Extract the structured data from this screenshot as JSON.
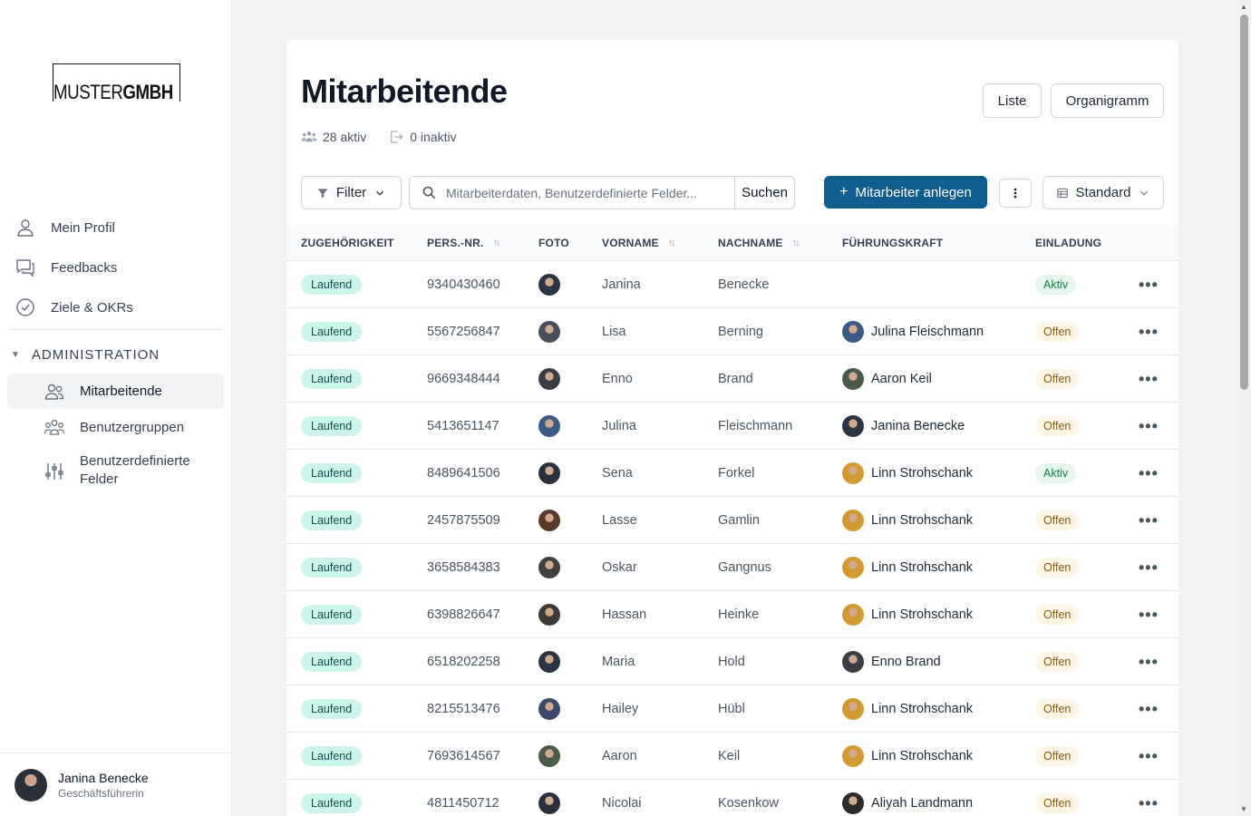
{
  "brand": {
    "logo_left": "MUSTER",
    "logo_right": "GMBH"
  },
  "nav": {
    "items": [
      {
        "label": "Mein Profil",
        "icon": "user-icon"
      },
      {
        "label": "Feedbacks",
        "icon": "chat-icon"
      },
      {
        "label": "Ziele & OKRs",
        "icon": "check-circle-icon"
      }
    ],
    "admin_label": "ADMINISTRATION",
    "admin_items": [
      {
        "label": "Mitarbeitende",
        "icon": "users-icon",
        "active": true
      },
      {
        "label": "Benutzergruppen",
        "icon": "group-icon"
      },
      {
        "label": "Benutzerdefinierte Felder",
        "icon": "sliders-icon"
      }
    ]
  },
  "user": {
    "name": "Janina Benecke",
    "role": "Geschäftsführerin"
  },
  "page": {
    "title": "Mitarbeitende",
    "active_count": "28 aktiv",
    "inactive_count": "0 inaktiv",
    "view_list": "Liste",
    "view_org": "Organigramm"
  },
  "toolbar": {
    "filter_label": "Filter",
    "search_placeholder": "Mitarbeiterdaten, Benutzerdefinierte Felder...",
    "search_button": "Suchen",
    "create_button": "Mitarbeiter anlegen",
    "view_select": "Standard"
  },
  "table": {
    "headers": [
      "ZUGEHÖRIGKEIT",
      "PERS.-NR.",
      "FOTO",
      "VORNAME",
      "NACHNAME",
      "FÜHRUNGSKRAFT",
      "EINLADUNG"
    ],
    "rows": [
      {
        "status": "Laufend",
        "nr": "9340430460",
        "first": "Janina",
        "last": "Benecke",
        "manager": "",
        "invite": "Aktiv",
        "photo": "#2c3546",
        "mphoto": ""
      },
      {
        "status": "Laufend",
        "nr": "5567256847",
        "first": "Lisa",
        "last": "Berning",
        "manager": "Julina Fleischmann",
        "invite": "Offen",
        "photo": "#4a4f5e",
        "mphoto": "#3b5a86"
      },
      {
        "status": "Laufend",
        "nr": "9669348444",
        "first": "Enno",
        "last": "Brand",
        "manager": "Aaron Keil",
        "invite": "Offen",
        "photo": "#3a3d44",
        "mphoto": "#4a5b4a"
      },
      {
        "status": "Laufend",
        "nr": "5413651147",
        "first": "Julina",
        "last": "Fleischmann",
        "manager": "Janina Benecke",
        "invite": "Offen",
        "photo": "#3b5a86",
        "mphoto": "#2c3546"
      },
      {
        "status": "Laufend",
        "nr": "8489641506",
        "first": "Sena",
        "last": "Forkel",
        "manager": "Linn Strohschank",
        "invite": "Aktiv",
        "photo": "#2b3040",
        "mphoto": "#d29a32"
      },
      {
        "status": "Laufend",
        "nr": "2457875509",
        "first": "Lasse",
        "last": "Gamlin",
        "manager": "Linn Strohschank",
        "invite": "Offen",
        "photo": "#5a3a2a",
        "mphoto": "#d29a32"
      },
      {
        "status": "Laufend",
        "nr": "3658584383",
        "first": "Oskar",
        "last": "Gangnus",
        "manager": "Linn Strohschank",
        "invite": "Offen",
        "photo": "#40403f",
        "mphoto": "#d29a32"
      },
      {
        "status": "Laufend",
        "nr": "6398826647",
        "first": "Hassan",
        "last": "Heinke",
        "manager": "Linn Strohschank",
        "invite": "Offen",
        "photo": "#3d3a38",
        "mphoto": "#d29a32"
      },
      {
        "status": "Laufend",
        "nr": "6518202258",
        "first": "Maria",
        "last": "Hold",
        "manager": "Enno Brand",
        "invite": "Offen",
        "photo": "#2c3446",
        "mphoto": "#3a3d44"
      },
      {
        "status": "Laufend",
        "nr": "8215513476",
        "first": "Hailey",
        "last": "Hübl",
        "manager": "Linn Strohschank",
        "invite": "Offen",
        "photo": "#3b4a6a",
        "mphoto": "#d29a32"
      },
      {
        "status": "Laufend",
        "nr": "7693614567",
        "first": "Aaron",
        "last": "Keil",
        "manager": "Linn Strohschank",
        "invite": "Offen",
        "photo": "#4a5b4a",
        "mphoto": "#d29a32"
      },
      {
        "status": "Laufend",
        "nr": "4811450712",
        "first": "Nicolai",
        "last": "Kosenkow",
        "manager": "Aliyah Landmann",
        "invite": "Offen",
        "photo": "#2a3040",
        "mphoto": "#2b2b2b"
      }
    ]
  }
}
